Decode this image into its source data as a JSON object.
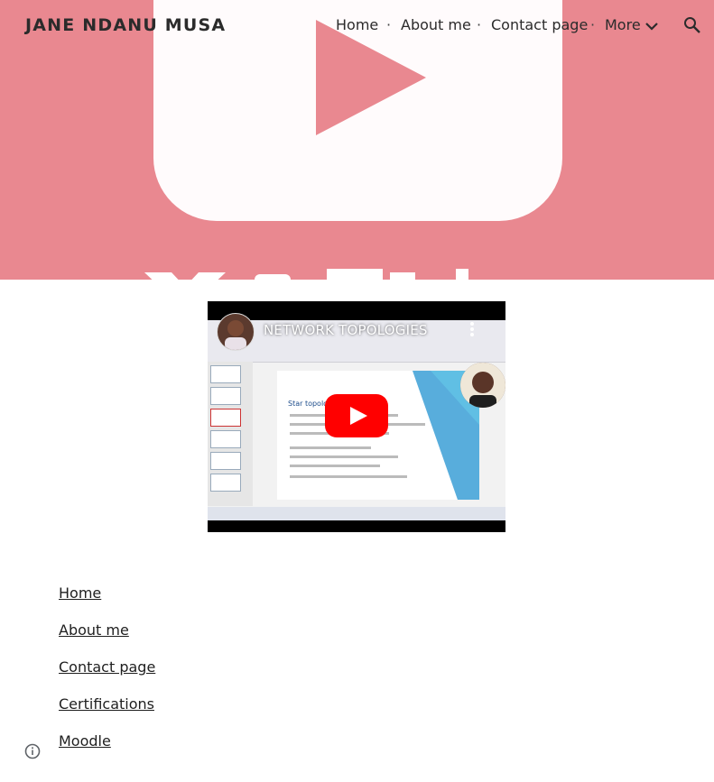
{
  "header": {
    "site_title": "JANE NDANU MUSA",
    "nav": [
      {
        "label": "Home"
      },
      {
        "label": "About me"
      },
      {
        "label": "Contact page"
      },
      {
        "label": "More"
      }
    ],
    "separator": "·",
    "icons": {
      "more": "chevron-down-icon",
      "search": "search-icon"
    }
  },
  "hero": {
    "accent": "#e98890",
    "icon": "youtube-logo-icon"
  },
  "video": {
    "title": "NETWORK TOPOLOGIES",
    "slide_heading": "Star topology",
    "icons": {
      "menu": "kebab-menu-icon",
      "play": "youtube-play-icon"
    },
    "play_color": "#ff0000"
  },
  "footer_nav": [
    {
      "label": "Home"
    },
    {
      "label": "About me "
    },
    {
      "label": "Contact page"
    },
    {
      "label": "Certifications"
    },
    {
      "label": "Moodle"
    }
  ],
  "footer": {
    "icon": "info-icon"
  }
}
